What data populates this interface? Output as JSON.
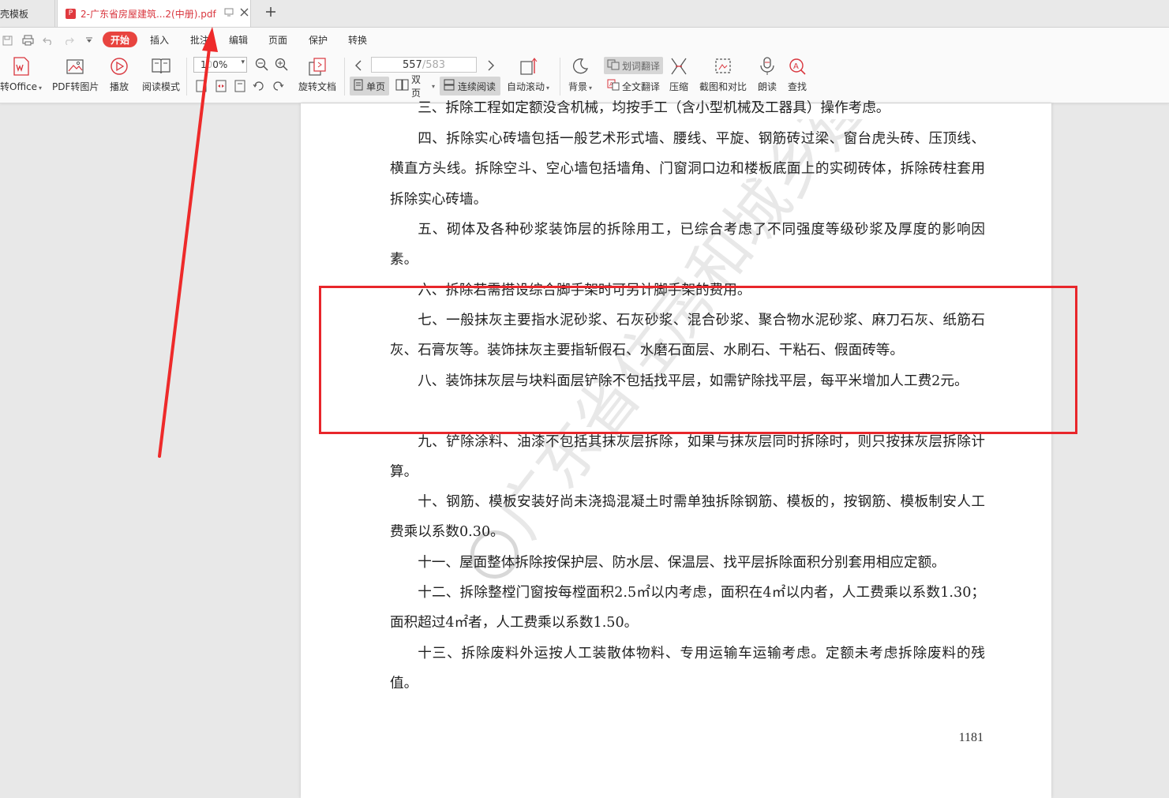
{
  "tabs": {
    "template_tab": "壳模板",
    "pdf_tab": "2-广东省房屋建筑...2(中册).pdf"
  },
  "menu": {
    "start": "开始",
    "insert": "插入",
    "annotate": "批注",
    "edit": "编辑",
    "page": "页面",
    "protect": "保护",
    "convert": "转换"
  },
  "toolbar": {
    "to_office": "转Office",
    "pdf_to_image": "PDF转图片",
    "play": "播放",
    "read_mode": "阅读模式",
    "zoom": "100%",
    "zoom_partial": "1",
    "zoom_rest": "0%",
    "page_current": "557",
    "page_total": "/583",
    "rotate": "旋转文档",
    "single_page": "单页",
    "double_page": "双页",
    "continuous": "连续阅读",
    "auto_scroll": "自动滚动",
    "background": "背景",
    "word_translate": "划词翻译",
    "full_translate": "全文翻译",
    "compress": "压缩",
    "screenshot_compare": "截图和对比",
    "read_aloud": "朗读",
    "search": "查找"
  },
  "document": {
    "paragraphs": [
      "三、拆除工程如定额没含机械，均按手工（含小型机械及工器具）操作考虑。",
      "四、拆除实心砖墙包括一般艺术形式墙、腰线、平旋、钢筋砖过梁、窗台虎头砖、压顶线、横直方头线。拆除空斗、空心墙包括墙角、门窗洞口边和楼板底面上的实砌砖体，拆除砖柱套用拆除实心砖墙。",
      "五、砌体及各种砂浆装饰层的拆除用工，已综合考虑了不同强度等级砂浆及厚度的影响因素。",
      "六、拆除若需搭设综合脚手架时可另计脚手架的费用。",
      "七、一般抹灰主要指水泥砂浆、石灰砂浆、混合砂浆、聚合物水泥砂浆、麻刀石灰、纸筋石灰、石膏灰等。装饰抹灰主要指斩假石、水磨石面层、水刷石、干粘石、假面砖等。",
      "八、装饰抹灰层与块料面层铲除不包括找平层，如需铲除找平层，每平米增加人工费2元。",
      "九、铲除涂料、油漆不包括其抹灰层拆除，如果与抹灰层同时拆除时，则只按抹灰层拆除计算。",
      "十、钢筋、模板安装好尚未浇捣混凝土时需单独拆除钢筋、模板的，按钢筋、模板制安人工费乘以系数0.30。",
      "十一、屋面整体拆除按保护层、防水层、保温层、找平层拆除面积分别套用相应定额。",
      "十二、拆除整樘门窗按每樘面积2.5㎡以内考虑，面积在4㎡以内者，人工费乘以系数1.30；面积超过4㎡者，人工费乘以系数1.50。",
      "十三、拆除废料外运按人工装散体物料、专用运输车运输考虑。定额未考虑拆除废料的残值。"
    ],
    "page_number": "1181",
    "watermark": "广东省住房和城乡建"
  },
  "colors": {
    "accent": "#e8443f",
    "annotation": "#e8262b"
  }
}
